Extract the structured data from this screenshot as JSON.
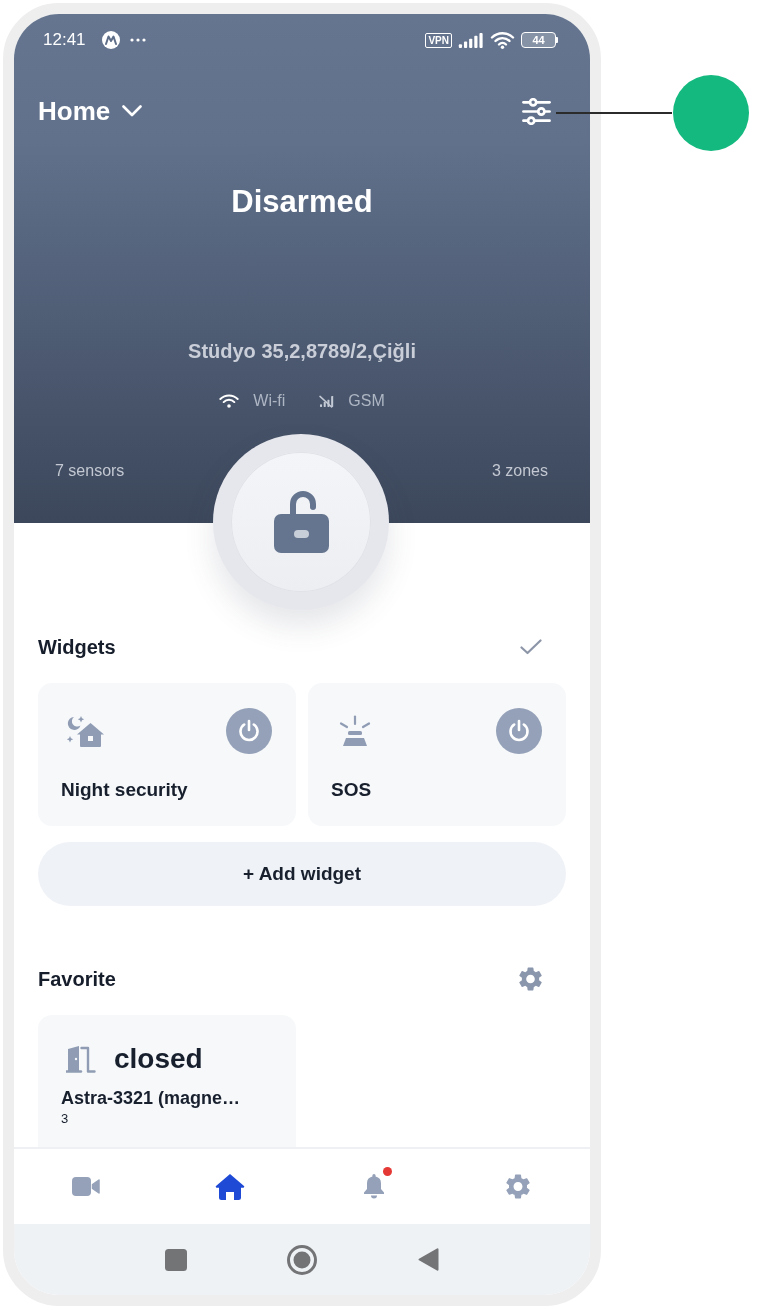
{
  "status_bar": {
    "time": "12:41",
    "vpn": "VPN",
    "battery": "44"
  },
  "header": {
    "location": "Home",
    "status": "Disarmed",
    "address": "Stüdyo 35,2,8789/2,Çiğli",
    "connections": [
      {
        "kind": "wifi",
        "label": "Wi-fi"
      },
      {
        "kind": "gsm",
        "label": "GSM"
      }
    ],
    "sensors": "7 sensors",
    "zones": "3 zones"
  },
  "widgets": {
    "title": "Widgets",
    "items": [
      {
        "kind": "night",
        "label": "Night security",
        "on": false
      },
      {
        "kind": "sos",
        "label": "SOS",
        "on": false
      }
    ],
    "add_button": "+ Add widget"
  },
  "favorite": {
    "title": "Favorite",
    "items": [
      {
        "kind": "door",
        "state": "closed",
        "name": "Astra-3321 (magne…",
        "number": "3"
      }
    ]
  },
  "bottom_nav": [
    {
      "kind": "camera",
      "selected": false,
      "notification_dot": false
    },
    {
      "kind": "home",
      "selected": true,
      "notification_dot": false
    },
    {
      "kind": "bell",
      "selected": false,
      "notification_dot": true
    },
    {
      "kind": "settings",
      "selected": false,
      "notification_dot": false
    }
  ]
}
